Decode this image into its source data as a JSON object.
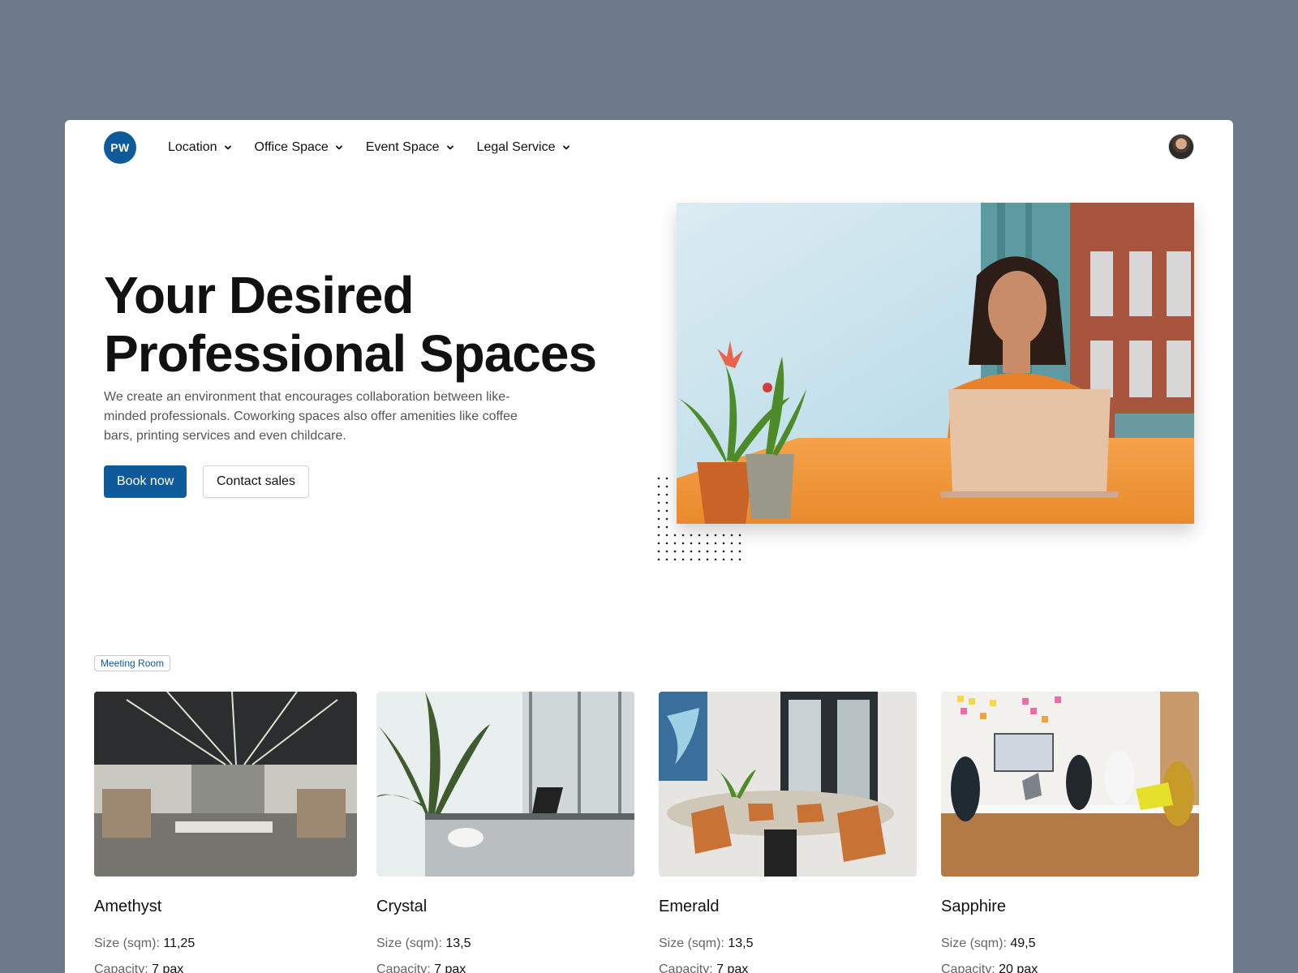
{
  "nav": {
    "logo_text": "PW",
    "items": [
      {
        "label": "Location"
      },
      {
        "label": "Office Space"
      },
      {
        "label": "Event Space"
      },
      {
        "label": "Legal Service"
      }
    ]
  },
  "hero": {
    "title_line1": "Your Desired",
    "title_line2": "Professional Spaces",
    "description": "We create an environment that encourages collaboration between like-minded professionals. Coworking spaces also offer amenities like coffee bars, printing services and even childcare.",
    "primary_button": "Book now",
    "secondary_button": "Contact sales"
  },
  "section": {
    "badge": "Meeting Room",
    "size_label": "Size (sqm):",
    "capacity_label": "Capacity:"
  },
  "rooms": [
    {
      "name": "Amethyst",
      "size": "11,25",
      "capacity": "7 pax"
    },
    {
      "name": "Crystal",
      "size": "13,5",
      "capacity": "7 pax"
    },
    {
      "name": "Emerald",
      "size": "13,5",
      "capacity": "7 pax"
    },
    {
      "name": "Sapphire",
      "size": "49,5",
      "capacity": "20 pax"
    }
  ],
  "colors": {
    "background": "#6c7a89",
    "brand": "#0e5a9b"
  }
}
